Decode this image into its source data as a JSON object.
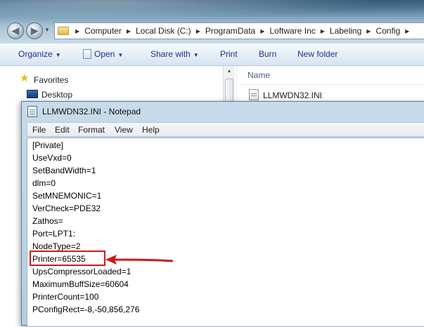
{
  "explorer": {
    "address": [
      "Computer",
      "Local Disk (C:)",
      "ProgramData",
      "Loftware Inc",
      "Labeling",
      "Config"
    ],
    "toolbar": {
      "organize": "Organize",
      "open": "Open",
      "share_with": "Share with",
      "print": "Print",
      "burn": "Burn",
      "new_folder": "New folder"
    },
    "nav": {
      "favorites": "Favorites",
      "desktop": "Desktop"
    },
    "column_header": "Name",
    "files": [
      "LLMWDN32.INI"
    ]
  },
  "notepad": {
    "title": "LLMWDN32.INI - Notepad",
    "menu": [
      "File",
      "Edit",
      "Format",
      "View",
      "Help"
    ],
    "lines": [
      "[Private]",
      "UseVxd=0",
      "SetBandWidth=1",
      "dlm=0",
      "SetMNEMONIC=1",
      "VerCheck=PDE32",
      "Zathos=",
      "Port=LPT1:",
      "NodeType=2",
      "Printer=65535",
      "UpsCompressorLoaded=1",
      "MaximumBuffSize=60604",
      "PrinterCount=100",
      "PConfigRect=-8,-50,856,276"
    ],
    "highlighted_line_index": 9
  },
  "colors": {
    "highlight": "#d01818",
    "toolbar_text": "#1e3287"
  }
}
